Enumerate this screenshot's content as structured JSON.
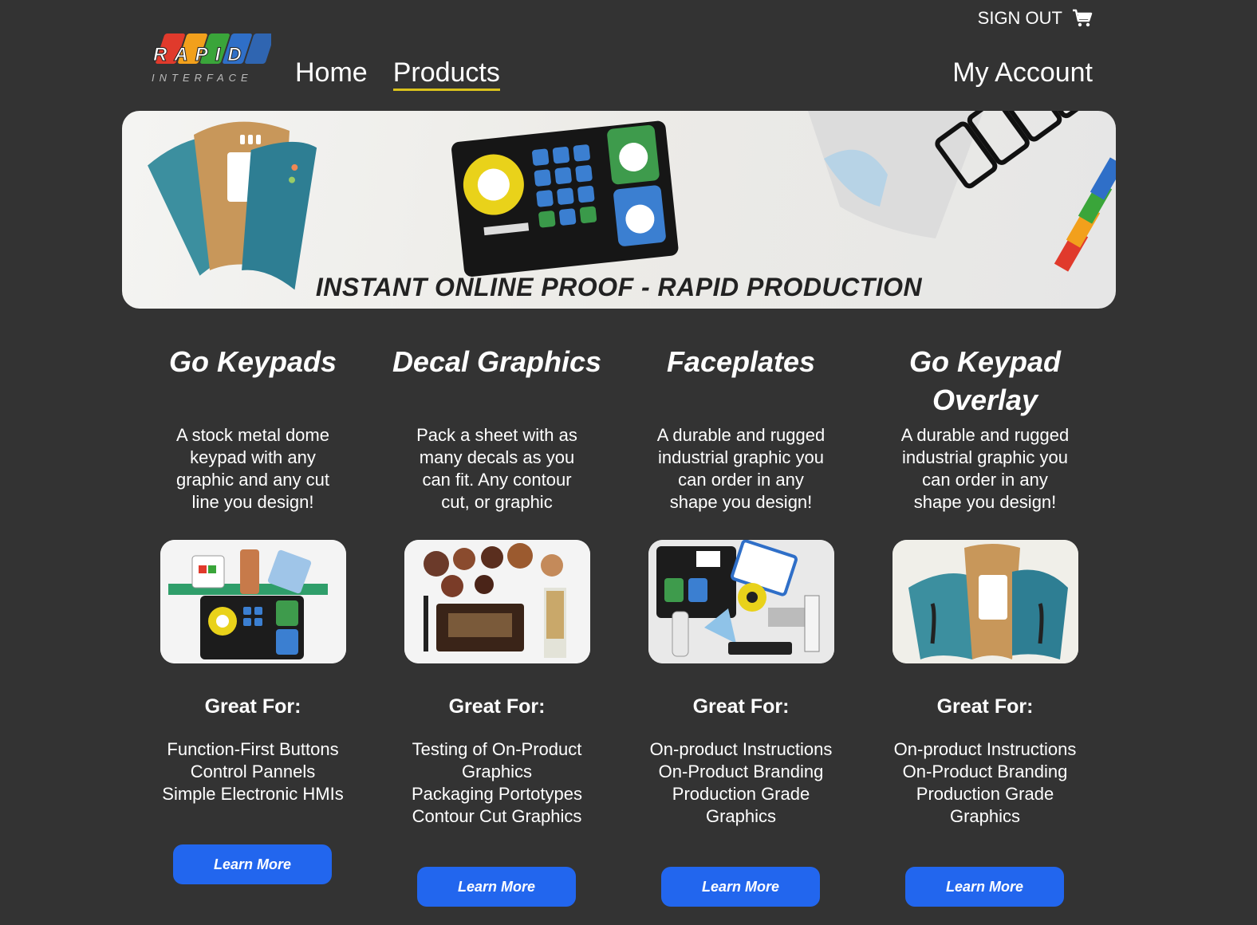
{
  "header": {
    "sign_out": "SIGN OUT",
    "cart_icon": "shopping-cart-icon",
    "logo_text_top": "RAPID",
    "logo_text_bottom": "INTERFACE",
    "nav": {
      "home": "Home",
      "products": "Products",
      "active": "Products"
    },
    "my_account": "My Account"
  },
  "banner": {
    "caption": "INSTANT ONLINE PROOF - RAPID PRODUCTION"
  },
  "products": [
    {
      "title": "Go Keypads",
      "description": "A stock metal dome keypad with any graphic and any cut line you design!",
      "great_for_label": "Great For:",
      "uses": [
        "Function-First Buttons",
        "Control Pannels",
        "Simple Electronic HMIs"
      ],
      "button": "Learn More"
    },
    {
      "title": "Decal Graphics",
      "description": "Pack a sheet with as many decals as you can fit. Any contour cut, or graphic",
      "great_for_label": "Great For:",
      "uses": [
        "Testing of On-Product",
        "Graphics",
        "Packaging Portotypes",
        "Contour Cut Graphics"
      ],
      "button": "Learn More"
    },
    {
      "title": "Faceplates",
      "description": "A durable and rugged industrial graphic you can order in any shape you design!",
      "great_for_label": "Great For:",
      "uses": [
        "On-product Instructions",
        "On-Product Branding",
        "Production Grade",
        "Graphics"
      ],
      "button": "Learn More"
    },
    {
      "title": "Go Keypad Overlay",
      "description": "A durable and rugged industrial graphic you can order in any shape you design!",
      "great_for_label": "Great For:",
      "uses": [
        "On-product Instructions",
        "On-Product Branding",
        "Production Grade",
        "Graphics"
      ],
      "button": "Learn More"
    }
  ],
  "colors": {
    "background": "#333333",
    "button": "#2266ee",
    "nav_underline": "#d9c21d"
  }
}
